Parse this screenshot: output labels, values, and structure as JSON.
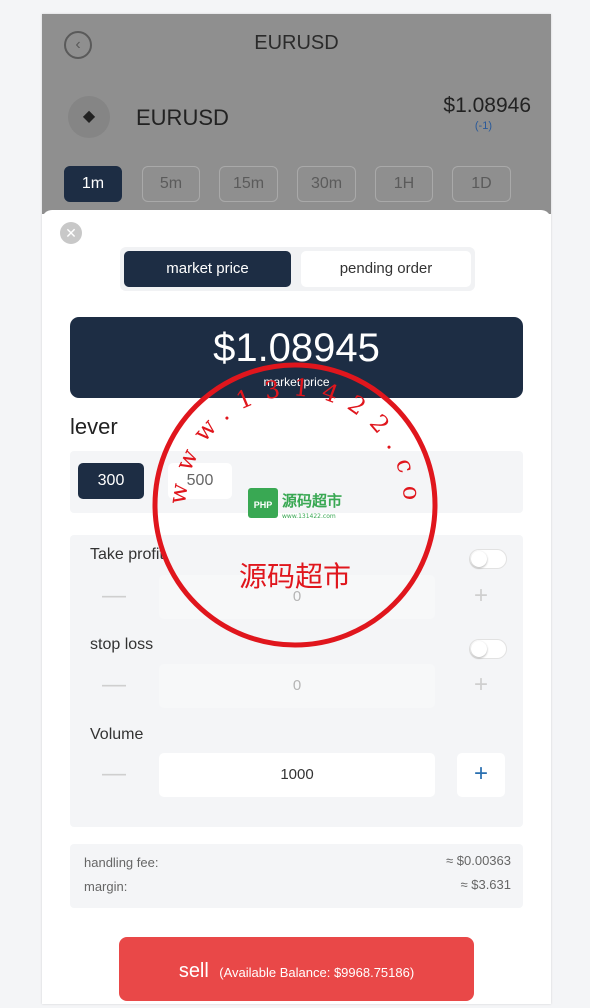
{
  "header": {
    "title": "EURUSD",
    "back_icon": "chevron-left-icon"
  },
  "instrument": {
    "icon": "layers-icon",
    "name": "EURUSD",
    "price": "$1.08946",
    "change": "(-1)"
  },
  "timeframes": [
    "1m",
    "5m",
    "15m",
    "30m",
    "1H",
    "1D"
  ],
  "timeframe_active": "1m",
  "order_sheet": {
    "close_icon": "close-icon",
    "tabs": {
      "market": "market price",
      "pending": "pending order"
    },
    "price": "$1.08945",
    "price_label": "market price",
    "lever_title": "lever",
    "lever_options": [
      "300",
      "500"
    ],
    "lever_active": "300",
    "take_profit": {
      "label": "Take profit",
      "value": "0",
      "minus": "—",
      "plus": "+"
    },
    "stop_loss": {
      "label": "stop loss",
      "value": "0",
      "minus": "—",
      "plus": "+"
    },
    "volume": {
      "label": "Volume",
      "value": "1000",
      "minus": "—",
      "plus": "+"
    },
    "fees": {
      "handling_fee_label": "handling fee:",
      "handling_fee_value": "≈ $0.00363",
      "margin_label": "margin:",
      "margin_value": "≈ $3.631"
    },
    "sell_button": {
      "label": "sell",
      "balance": "(Available Balance: $9968.75186)"
    }
  },
  "watermark": {
    "url_text": "www.131422.com",
    "name_text": "源码超市",
    "badge_text": "源码超市",
    "badge_sub": "www.131422.com",
    "php_label": "PHP",
    "color": "#e0161d"
  }
}
